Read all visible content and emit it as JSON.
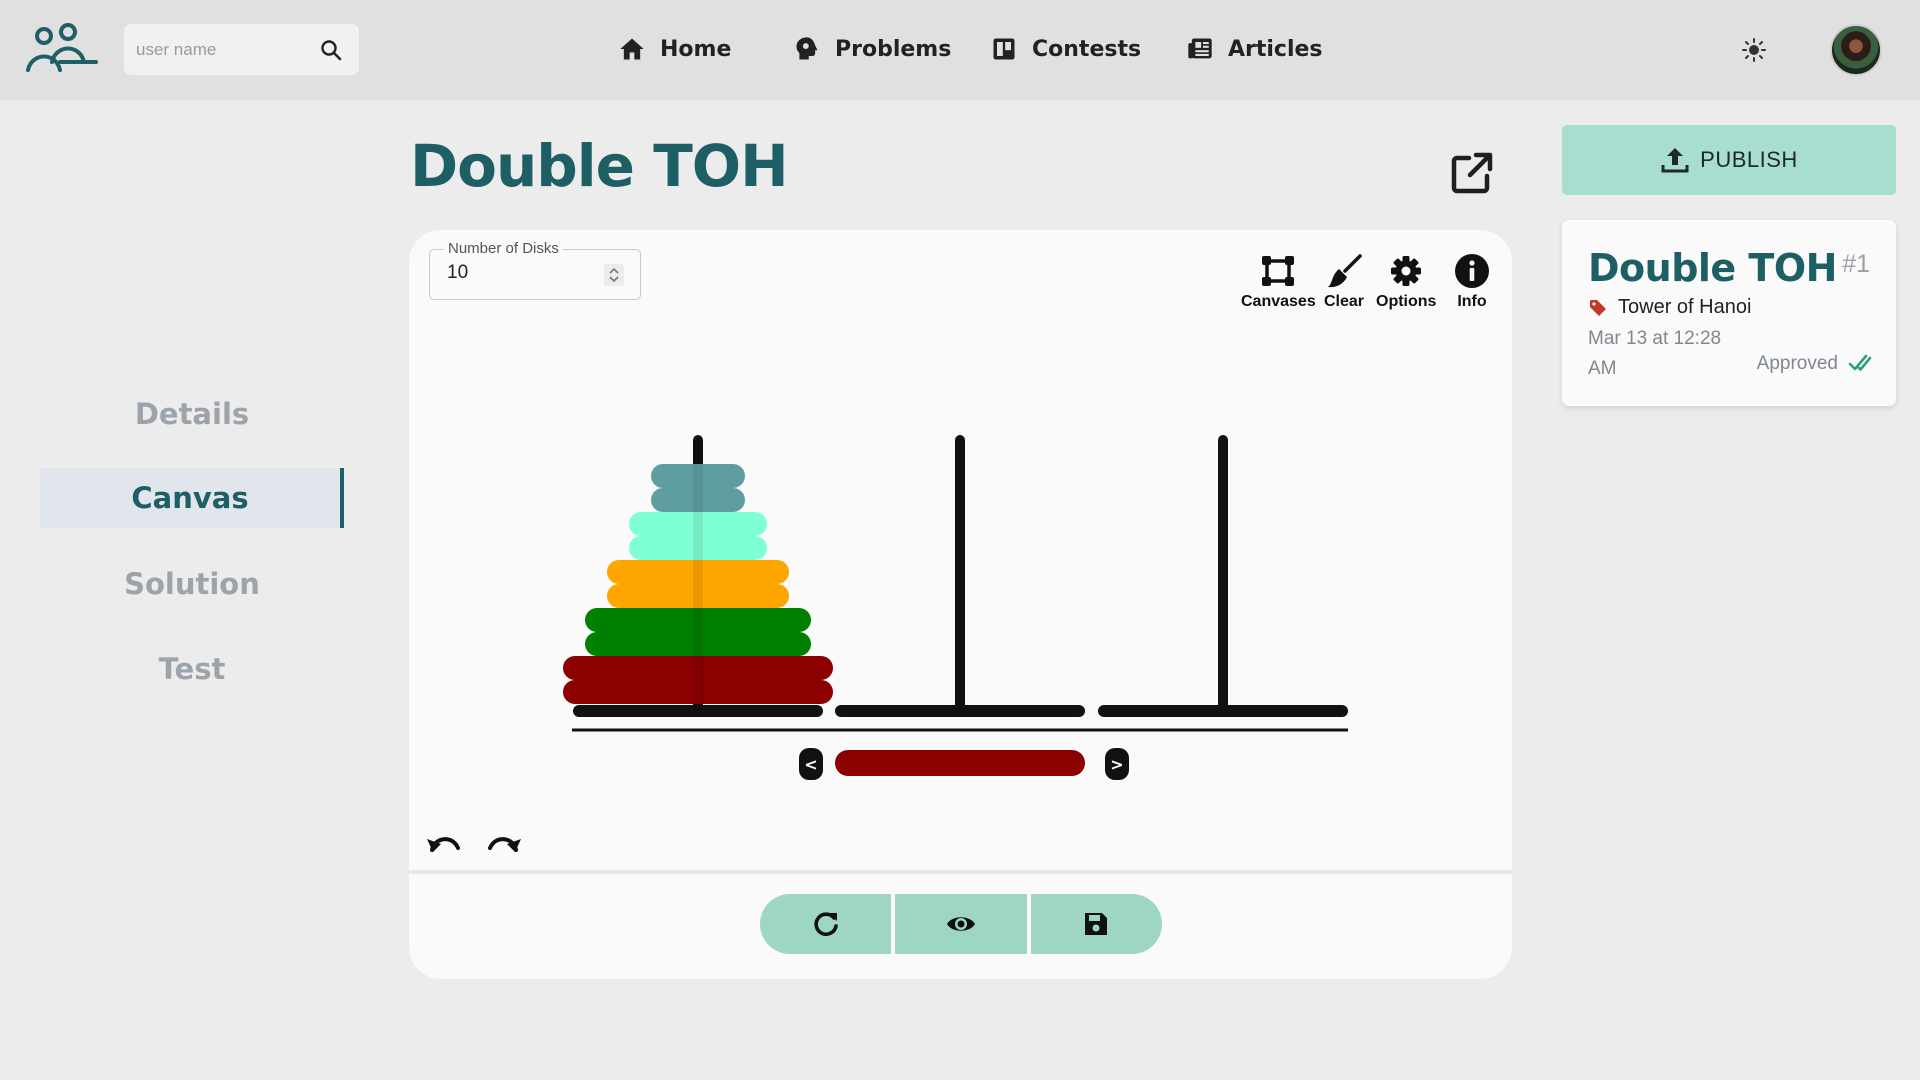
{
  "nav": {
    "search_placeholder": "user name",
    "items": [
      {
        "label": "Home",
        "icon": "home-icon"
      },
      {
        "label": "Problems",
        "icon": "brain-icon"
      },
      {
        "label": "Contests",
        "icon": "board-icon"
      },
      {
        "label": "Articles",
        "icon": "newspaper-icon"
      }
    ],
    "theme_icon": "sun-icon"
  },
  "sidebar": {
    "items": [
      {
        "label": "Details",
        "active": false
      },
      {
        "label": "Canvas",
        "active": true
      },
      {
        "label": "Solution",
        "active": false
      },
      {
        "label": "Test",
        "active": false
      }
    ]
  },
  "page": {
    "title": "Double TOH"
  },
  "canvas": {
    "disk_field": {
      "label": "Number of Disks",
      "value": "10"
    },
    "tools": [
      {
        "label": "Canvases",
        "icon": "canvases-icon"
      },
      {
        "label": "Clear",
        "icon": "broom-icon"
      },
      {
        "label": "Options",
        "icon": "gear-icon"
      },
      {
        "label": "Info",
        "icon": "info-icon"
      }
    ],
    "towers": {
      "peg_count": 3,
      "disks_on_peg_1": [
        {
          "color": "#5e9ea0",
          "size": 1
        },
        {
          "color": "#5e9ea0",
          "size": 1
        },
        {
          "color": "#7fffd4",
          "size": 2
        },
        {
          "color": "#7fffd4",
          "size": 2
        },
        {
          "color": "#ffa500",
          "size": 3
        },
        {
          "color": "#ffa500",
          "size": 3
        },
        {
          "color": "#008000",
          "size": 4
        },
        {
          "color": "#008000",
          "size": 4
        },
        {
          "color": "#8b0000",
          "size": 5
        },
        {
          "color": "#8b0000",
          "size": 5
        }
      ],
      "selected_disk_color": "#8b0000",
      "prev_label": "<",
      "next_label": ">"
    },
    "actions": [
      "refresh-icon",
      "eye-icon",
      "save-icon"
    ]
  },
  "panel": {
    "publish_label": "PUBLISH",
    "problem": {
      "title": "Double TOH",
      "number": "#1",
      "tag": "Tower of Hanoi",
      "date": "Mar 13 at 12:28 AM",
      "status": "Approved"
    }
  },
  "colors": {
    "accent": "#1e5f66",
    "action_button": "#9ed6c5",
    "publish_button": "#a8ded0",
    "approved": "#2fa07a",
    "tag": "#c0392b"
  }
}
